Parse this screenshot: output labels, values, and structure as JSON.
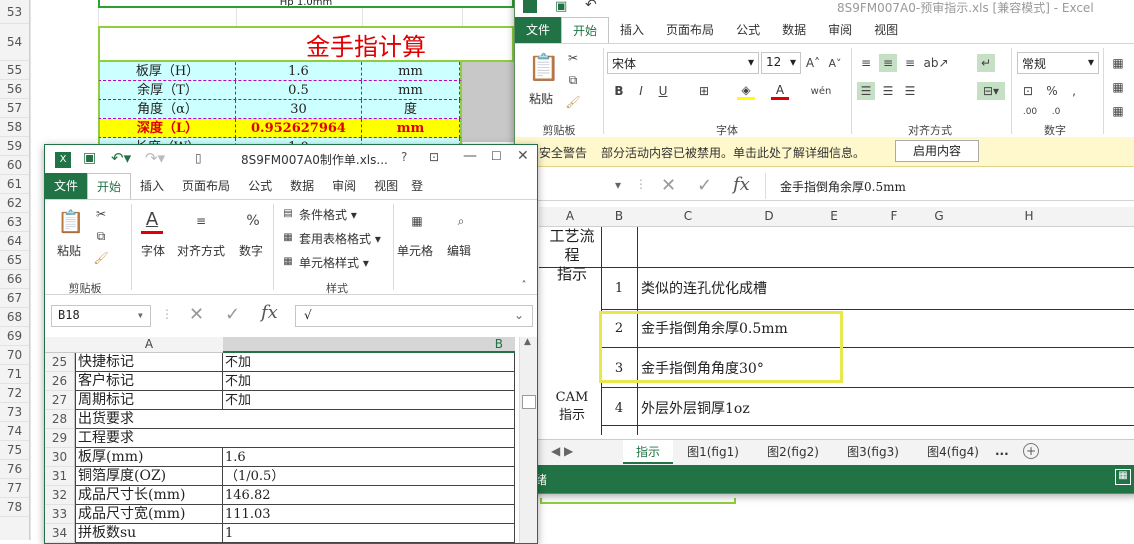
{
  "bg_sheet": {
    "rows": [
      "53",
      "54",
      "55",
      "56",
      "57",
      "58",
      "59",
      "60",
      "61",
      "62",
      "63",
      "64",
      "65",
      "66",
      "67",
      "68",
      "69",
      "70",
      "71",
      "72",
      "73",
      "74",
      "75",
      "76",
      "77",
      "78"
    ],
    "top_cell": "Hp 1.0mm",
    "title": "金手指计算",
    "calc": [
      {
        "label": "板厚（H）",
        "value": "1.6",
        "unit": "mm",
        "bg": "#ccffff"
      },
      {
        "label": "余厚（T）",
        "value": "0.5",
        "unit": "mm",
        "bg": "#ccffff"
      },
      {
        "label": "角度（α）",
        "value": "30",
        "unit": "度",
        "bg": "#ccffff"
      },
      {
        "label": "深度（L）",
        "value": "0.952627964",
        "unit": "mm",
        "bg": "#ffff00"
      },
      {
        "label": "长度（W）",
        "value": "1.0",
        "unit": "",
        "bg": "#ccffff"
      }
    ]
  },
  "right_win": {
    "title": "8S9FM007A0-预审指示.xls [兼容模式] - Excel",
    "tabs": [
      "文件",
      "开始",
      "插入",
      "页面布局",
      "公式",
      "数据",
      "审阅",
      "视图"
    ],
    "font_name": "宋体",
    "font_size": "12",
    "number_format": "常规",
    "groups": [
      "剪贴板",
      "字体",
      "对齐方式",
      "数字"
    ],
    "paste_label": "粘贴",
    "security_label": "安全警告",
    "security_msg": "部分活动内容已被禁用。单击此处了解详细信息。",
    "enable_btn": "启用内容",
    "formula": "金手指倒角余厚0.5mm",
    "cols": [
      "A",
      "B",
      "C",
      "D",
      "E",
      "F",
      "G",
      "H"
    ],
    "process_header": "工艺流程\n指示",
    "cam_label": "CAM\n指示",
    "rows": [
      {
        "n": "1",
        "text": "类似的连孔优化成槽"
      },
      {
        "n": "2",
        "text": "金手指倒角余厚0.5mm"
      },
      {
        "n": "3",
        "text": "金手指倒角角度30°"
      },
      {
        "n": "4",
        "text": "外层外层铜厚1oz"
      }
    ],
    "sheet_tabs": [
      "指示",
      "图1(fig1)",
      "图2(fig2)",
      "图3(fig3)",
      "图4(fig4)"
    ],
    "more": "...",
    "status_text": "绪"
  },
  "left_win": {
    "title": "8S9FM007A0制作单.xls...",
    "help": "?",
    "tabs": [
      "文件",
      "开始",
      "插入",
      "页面布局",
      "公式",
      "数据",
      "审阅",
      "视图"
    ],
    "tab_extra": "登",
    "buttons": {
      "paste": "粘贴",
      "font": "字体",
      "align": "对齐方式",
      "number": "数字",
      "cond": "条件格式",
      "table": "套用表格格式",
      "cellstyle": "单元格样式",
      "cells": "单元格",
      "edit": "编辑"
    },
    "groups": [
      "剪贴板",
      "样式"
    ],
    "namebox": "B18",
    "formula": "√",
    "cols": [
      "A",
      "B"
    ],
    "rows": [
      {
        "n": "25",
        "a": "快捷标记",
        "b": "不加"
      },
      {
        "n": "26",
        "a": "客户标记",
        "b": "不加"
      },
      {
        "n": "27",
        "a": "周期标记",
        "b": "不加"
      },
      {
        "n": "28",
        "a": "出货要求",
        "b": ""
      },
      {
        "n": "29",
        "a": "工程要求",
        "b": ""
      },
      {
        "n": "30",
        "a": "板厚(mm)",
        "b": "1.6"
      },
      {
        "n": "31",
        "a": "铜箔厚度(OZ)",
        "b": "（1/0.5）"
      },
      {
        "n": "32",
        "a": "成品尺寸长(mm)",
        "b": "146.82"
      },
      {
        "n": "33",
        "a": "成品尺寸宽(mm)",
        "b": "111.03"
      },
      {
        "n": "34",
        "a": "拼板数su",
        "b": "1"
      }
    ]
  }
}
